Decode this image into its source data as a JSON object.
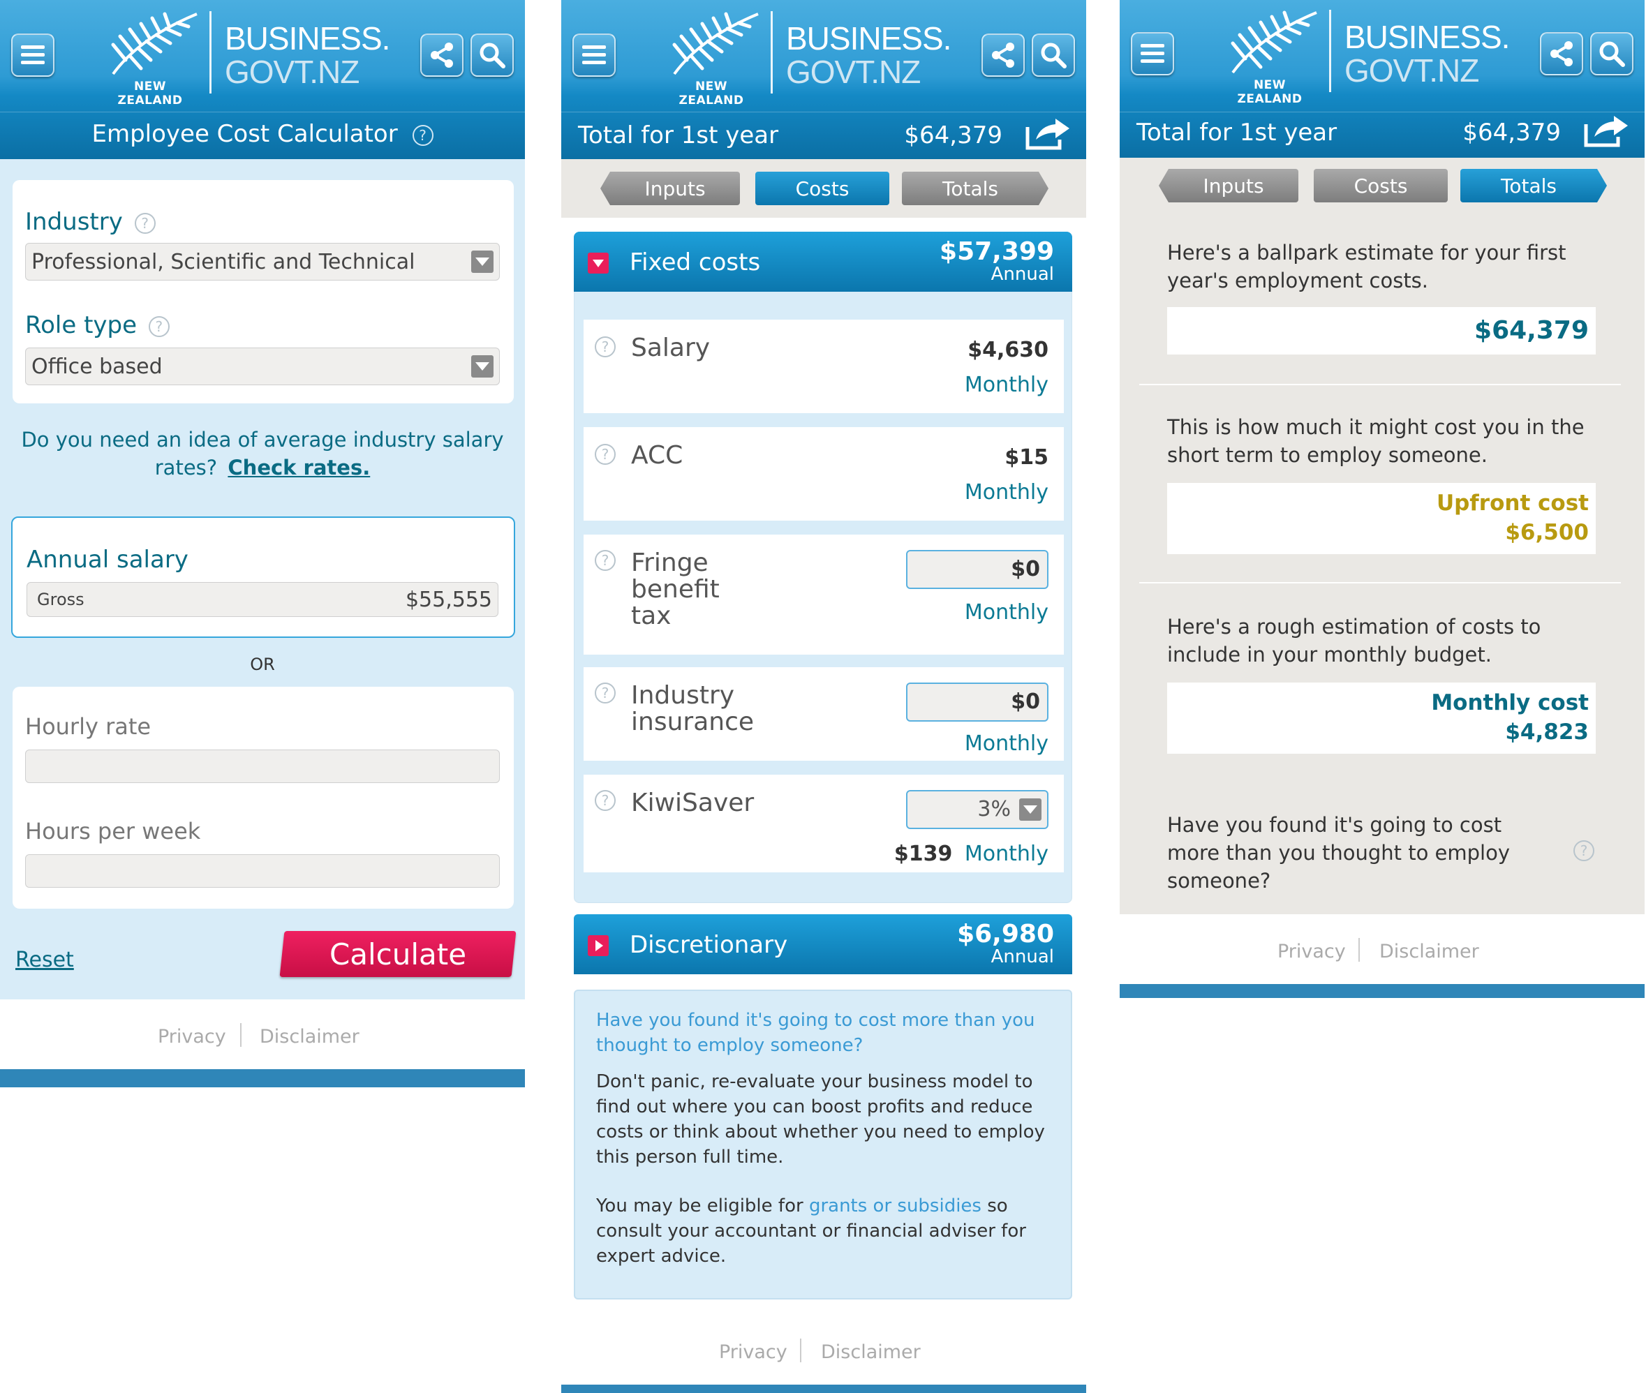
{
  "brand": {
    "country": "NEW ZEALAND",
    "line1": "BUSINESS.",
    "line2": "GOVT.NZ"
  },
  "icons": {
    "menu": "menu-icon",
    "share": "share-icon",
    "search": "search-icon",
    "export": "export-icon",
    "help": "help-icon"
  },
  "colors": {
    "header_blue": "#1489c5",
    "light_bg": "#d8ecf8",
    "calculate_red": "#d8134d",
    "teal_text": "#0a6b83",
    "gold_text": "#b89a10",
    "bar_blue": "#2f86b8"
  },
  "panel1": {
    "title": "Employee Cost Calculator",
    "help_glyph": "?",
    "industry_label": "Industry",
    "industry_value": "Professional, Scientific and Technical",
    "role_label": "Role type",
    "role_value": "Office based",
    "rates_prompt": "Do you need an idea of average industry salary rates?",
    "rates_link": "Check rates.",
    "annual_salary_label": "Annual salary",
    "gross_label": "Gross",
    "gross_value": "$55,555",
    "or_label": "OR",
    "hourly_rate_label": "Hourly rate",
    "hours_per_week_label": "Hours per week",
    "reset_label": "Reset",
    "calculate_label": "Calculate"
  },
  "header_total": {
    "label": "Total for 1st year",
    "amount": "$64,379"
  },
  "tabs": [
    "Inputs",
    "Costs",
    "Totals"
  ],
  "panel2": {
    "fixed": {
      "title": "Fixed costs",
      "amount": "$57,399",
      "period": "Annual"
    },
    "rows": [
      {
        "name": "Salary",
        "value": "$4,630",
        "period": "Monthly"
      },
      {
        "name": "ACC",
        "value": "$15",
        "period": "Monthly"
      },
      {
        "name": "Fringe benefit tax",
        "name_lines": [
          "Fringe",
          "benefit",
          "tax"
        ],
        "value": "$0",
        "period": "Monthly"
      },
      {
        "name": "Industry insurance",
        "name_lines": [
          "Industry",
          "insurance"
        ],
        "value": "$0",
        "period": "Monthly"
      },
      {
        "name": "KiwiSaver",
        "value": "3%",
        "amount": "$139",
        "period": "Monthly"
      }
    ],
    "discretionary": {
      "title": "Discretionary",
      "amount": "$6,980",
      "period": "Annual"
    },
    "info": {
      "question": "Have you found it's going to cost more than you thought to employ someone?",
      "para1": "Don't panic, re-evaluate your business model to find out where you can boost profits and reduce costs or think about whether you need to employ this person full time.",
      "para2_a": "You may be eligible for",
      "para2_link": "grants or subsidies",
      "para2_b": "so consult your accountant or financial adviser for expert advice."
    }
  },
  "panel3": {
    "estimate_text": "Here's a ballpark estimate for your first year's employment costs.",
    "estimate_value": "$64,379",
    "short_term_text": "This is how much it might cost you in the short term to employ someone.",
    "upfront_label": "Upfront cost",
    "upfront_value": "$6,500",
    "monthly_text": "Here's a rough estimation of costs to include in your monthly budget.",
    "monthly_label": "Monthly cost",
    "monthly_value": "$4,823",
    "question": "Have you found it's going to cost more than you thought to employ someone?"
  },
  "footer": {
    "privacy": "Privacy",
    "disclaimer": "Disclaimer"
  }
}
